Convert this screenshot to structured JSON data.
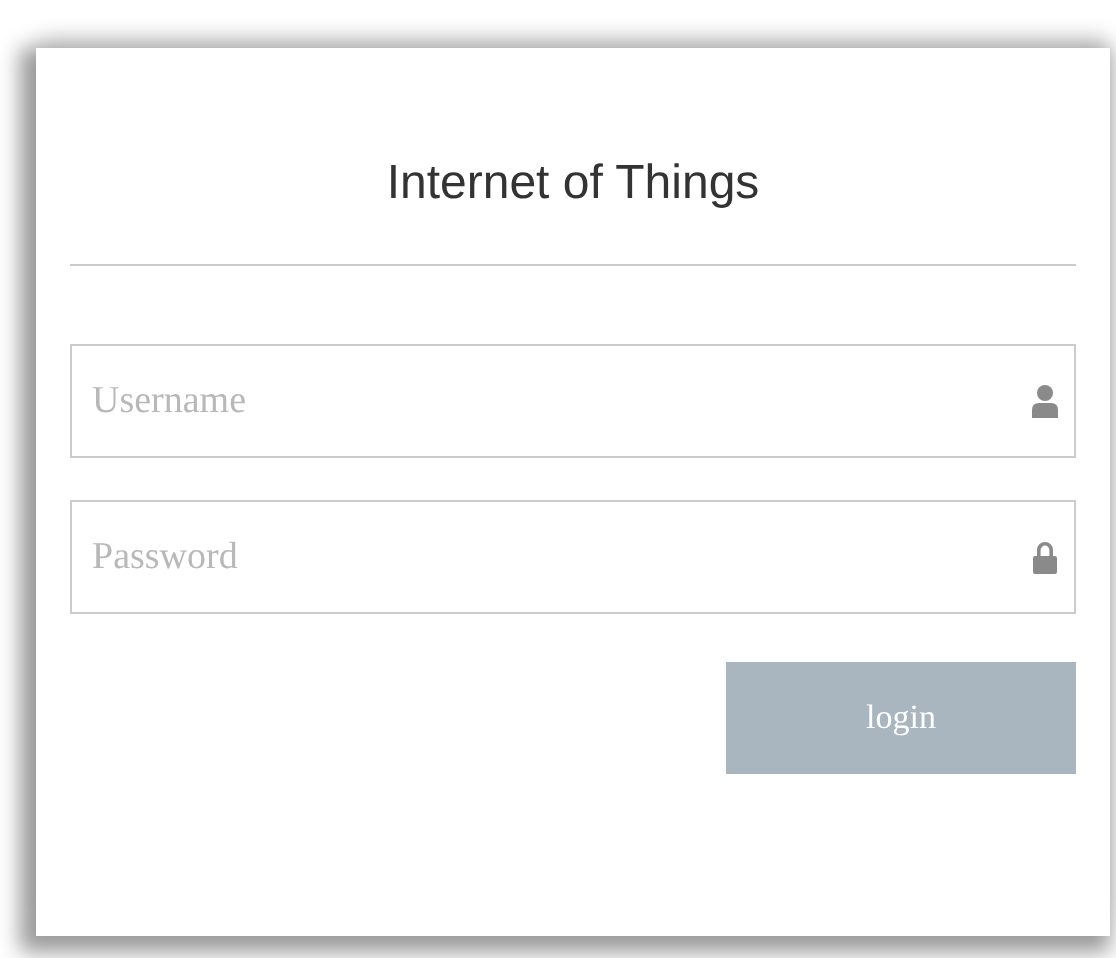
{
  "title": "Internet of Things",
  "fields": [
    {
      "placeholder": "Username",
      "kind": "user"
    },
    {
      "placeholder": "Password",
      "kind": "lock"
    }
  ],
  "button": "login"
}
